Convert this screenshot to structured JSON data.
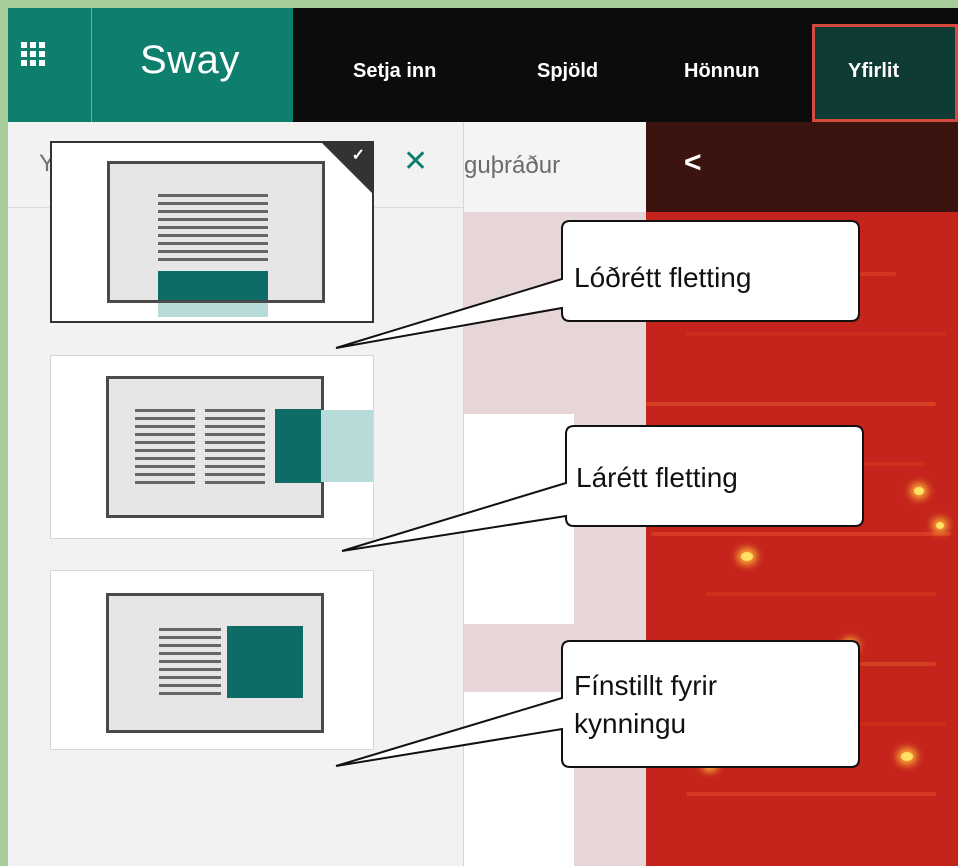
{
  "app": {
    "brand": "Sway",
    "accent_color": "#0e7f6d"
  },
  "topnav": {
    "items": [
      {
        "label": "Setja inn"
      },
      {
        "label": "Spjöld"
      },
      {
        "label": "Hönnun"
      },
      {
        "label": "Yfirlit",
        "selected": true
      }
    ],
    "waffle_icon": "app-launcher-grid-icon"
  },
  "panel": {
    "title": "Yfirlit",
    "close_icon": "close-icon",
    "options": [
      {
        "name": "vertical-scroll",
        "selected": true
      },
      {
        "name": "horizontal-scroll",
        "selected": false
      },
      {
        "name": "presentation",
        "selected": false
      }
    ]
  },
  "middle": {
    "tab_text": "guþráður"
  },
  "preview": {
    "back_icon": "chevron-left-icon"
  },
  "callouts": {
    "vertical": "Lóðrétt fletting",
    "horizontal": "Lárétt fletting",
    "presentation_line1": "Fínstillt fyrir",
    "presentation_line2": "kynningu"
  }
}
